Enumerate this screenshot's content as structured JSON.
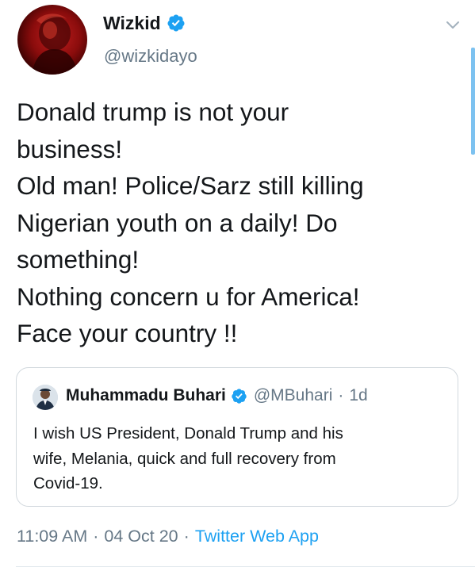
{
  "tweet": {
    "author": {
      "name": "Wizkid",
      "handle": "@wizkidayo",
      "verified": true,
      "avatar_icon": "profile-photo-red"
    },
    "text": "Donald trump is not your\nbusiness!\nOld man! Police/Sarz still killing\nNigerian youth on a daily! Do\nsomething!\nNothing concern u for America!\nFace your country !!",
    "time": "11:09 AM",
    "date": "04 Oct 20",
    "source": "Twitter Web App",
    "separator": "·"
  },
  "quoted_tweet": {
    "author": {
      "name": "Muhammadu Buhari",
      "handle": "@MBuhari",
      "verified": true
    },
    "separator": "·",
    "time": "1d",
    "text": "I wish US President, Donald Trump and his\nwife, Melania, quick and full recovery from\nCovid-19."
  },
  "colors": {
    "text": "#14171a",
    "secondary": "#657786",
    "accent": "#1da1f2",
    "border": "#d2d9de"
  },
  "icons": {
    "verified": "verified-badge-icon",
    "more": "chevron-down-icon"
  }
}
